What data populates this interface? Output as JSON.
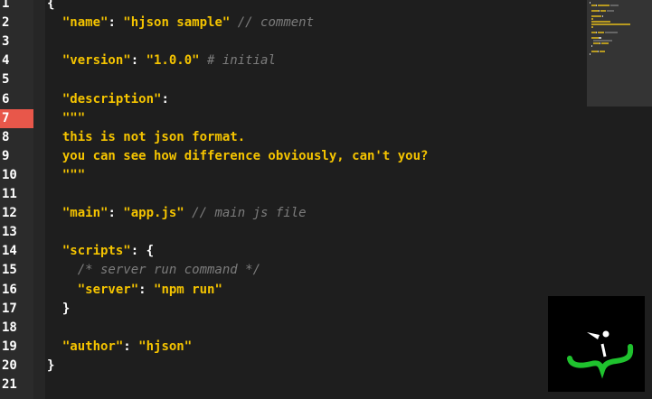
{
  "editor": {
    "active_line": 7,
    "line_numbers": [
      "1",
      "2",
      "3",
      "4",
      "5",
      "6",
      "7",
      "8",
      "9",
      "10",
      "11",
      "12",
      "13",
      "14",
      "15",
      "16",
      "17",
      "18",
      "19",
      "20",
      "21"
    ],
    "lines": [
      [
        {
          "t": "{",
          "k": "p"
        }
      ],
      [
        {
          "t": "  ",
          "k": "p"
        },
        {
          "t": "\"name\"",
          "k": "s"
        },
        {
          "t": ": ",
          "k": "p"
        },
        {
          "t": "\"hjson sample\"",
          "k": "s"
        },
        {
          "t": " // comment",
          "k": "c"
        }
      ],
      [],
      [
        {
          "t": "  ",
          "k": "p"
        },
        {
          "t": "\"version\"",
          "k": "s"
        },
        {
          "t": ": ",
          "k": "p"
        },
        {
          "t": "\"1.0.0\"",
          "k": "s"
        },
        {
          "t": " # initial",
          "k": "c"
        }
      ],
      [],
      [
        {
          "t": "  ",
          "k": "p"
        },
        {
          "t": "\"description\"",
          "k": "s"
        },
        {
          "t": ":",
          "k": "p"
        }
      ],
      [
        {
          "t": "  ",
          "k": "p"
        },
        {
          "t": "'''",
          "k": "s"
        }
      ],
      [
        {
          "t": "  this is not json format.",
          "k": "s"
        }
      ],
      [
        {
          "t": "  you can see how difference obviously, can't you?",
          "k": "s"
        }
      ],
      [
        {
          "t": "  ",
          "k": "p"
        },
        {
          "t": "'''",
          "k": "s"
        }
      ],
      [],
      [
        {
          "t": "  ",
          "k": "p"
        },
        {
          "t": "\"main\"",
          "k": "s"
        },
        {
          "t": ": ",
          "k": "p"
        },
        {
          "t": "\"app.js\"",
          "k": "s"
        },
        {
          "t": " // main js file",
          "k": "c"
        }
      ],
      [],
      [
        {
          "t": "  ",
          "k": "p"
        },
        {
          "t": "\"scripts\"",
          "k": "s"
        },
        {
          "t": ": {",
          "k": "p"
        }
      ],
      [
        {
          "t": "    /* server run command */",
          "k": "c"
        }
      ],
      [
        {
          "t": "    ",
          "k": "p"
        },
        {
          "t": "\"server\"",
          "k": "s"
        },
        {
          "t": ": ",
          "k": "p"
        },
        {
          "t": "\"npm run\"",
          "k": "s"
        }
      ],
      [
        {
          "t": "  }",
          "k": "p"
        }
      ],
      [],
      [
        {
          "t": "  ",
          "k": "p"
        },
        {
          "t": "\"author\"",
          "k": "s"
        },
        {
          "t": ": ",
          "k": "p"
        },
        {
          "t": "\"hjson\"",
          "k": "s"
        }
      ],
      [
        {
          "t": "}",
          "k": "p"
        }
      ],
      []
    ]
  },
  "colors": {
    "string": "#f5c400",
    "comment": "#7c7c7c",
    "active_line": "#e8574a",
    "logo_brace": "#1fc22e"
  },
  "logo": {
    "icon": "hjson-logo"
  }
}
